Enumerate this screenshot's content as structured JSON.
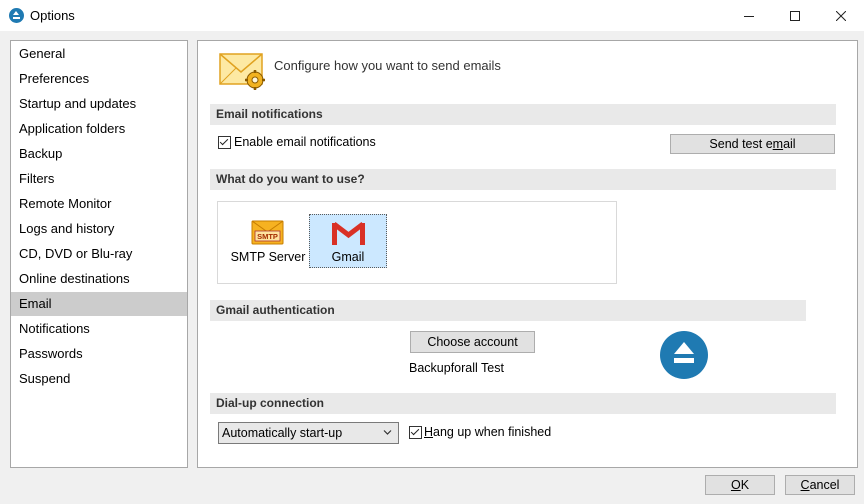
{
  "window": {
    "title": "Options",
    "controls": [
      "minimize-icon",
      "maximize-icon",
      "close-icon"
    ]
  },
  "sidebar": {
    "items": [
      {
        "label": "General"
      },
      {
        "label": "Preferences"
      },
      {
        "label": "Startup and updates"
      },
      {
        "label": "Application folders"
      },
      {
        "label": "Backup"
      },
      {
        "label": "Filters"
      },
      {
        "label": "Remote Monitor"
      },
      {
        "label": "Logs and history"
      },
      {
        "label": "CD, DVD or Blu-ray"
      },
      {
        "label": "Online destinations"
      },
      {
        "label": "Email"
      },
      {
        "label": "Notifications"
      },
      {
        "label": "Passwords"
      },
      {
        "label": "Suspend"
      }
    ],
    "selected": "Email"
  },
  "main": {
    "header_icon": "envelope-gear-icon",
    "header_text": "Configure how you want to send emails",
    "email_notifications": {
      "section_title": "Email notifications",
      "enable_label": "Enable email notifications",
      "enable_checked": true,
      "test_button_pre": "Send test e",
      "test_button_u": "m",
      "test_button_post": "ail"
    },
    "use_section": {
      "section_title": "What do you want to use?",
      "options": [
        {
          "label": "SMTP Server",
          "icon": "smtp-envelope-icon",
          "icon_text": "SMTP",
          "selected": false
        },
        {
          "label": "Gmail",
          "icon": "gmail-icon",
          "selected": true
        }
      ]
    },
    "gmail_auth": {
      "section_title": "Gmail authentication",
      "choose_button": "Choose account",
      "account_name": "Backupforall Test",
      "logo_icon": "backup4all-logo-icon"
    },
    "dialup": {
      "section_title": "Dial-up connection",
      "select_value": "Automatically start-up",
      "hangup_u": "H",
      "hangup_rest": "ang up when finished",
      "hangup_checked": true
    }
  },
  "footer": {
    "ok_u": "O",
    "ok_rest": "K",
    "cancel_u": "C",
    "cancel_rest": "ancel"
  }
}
